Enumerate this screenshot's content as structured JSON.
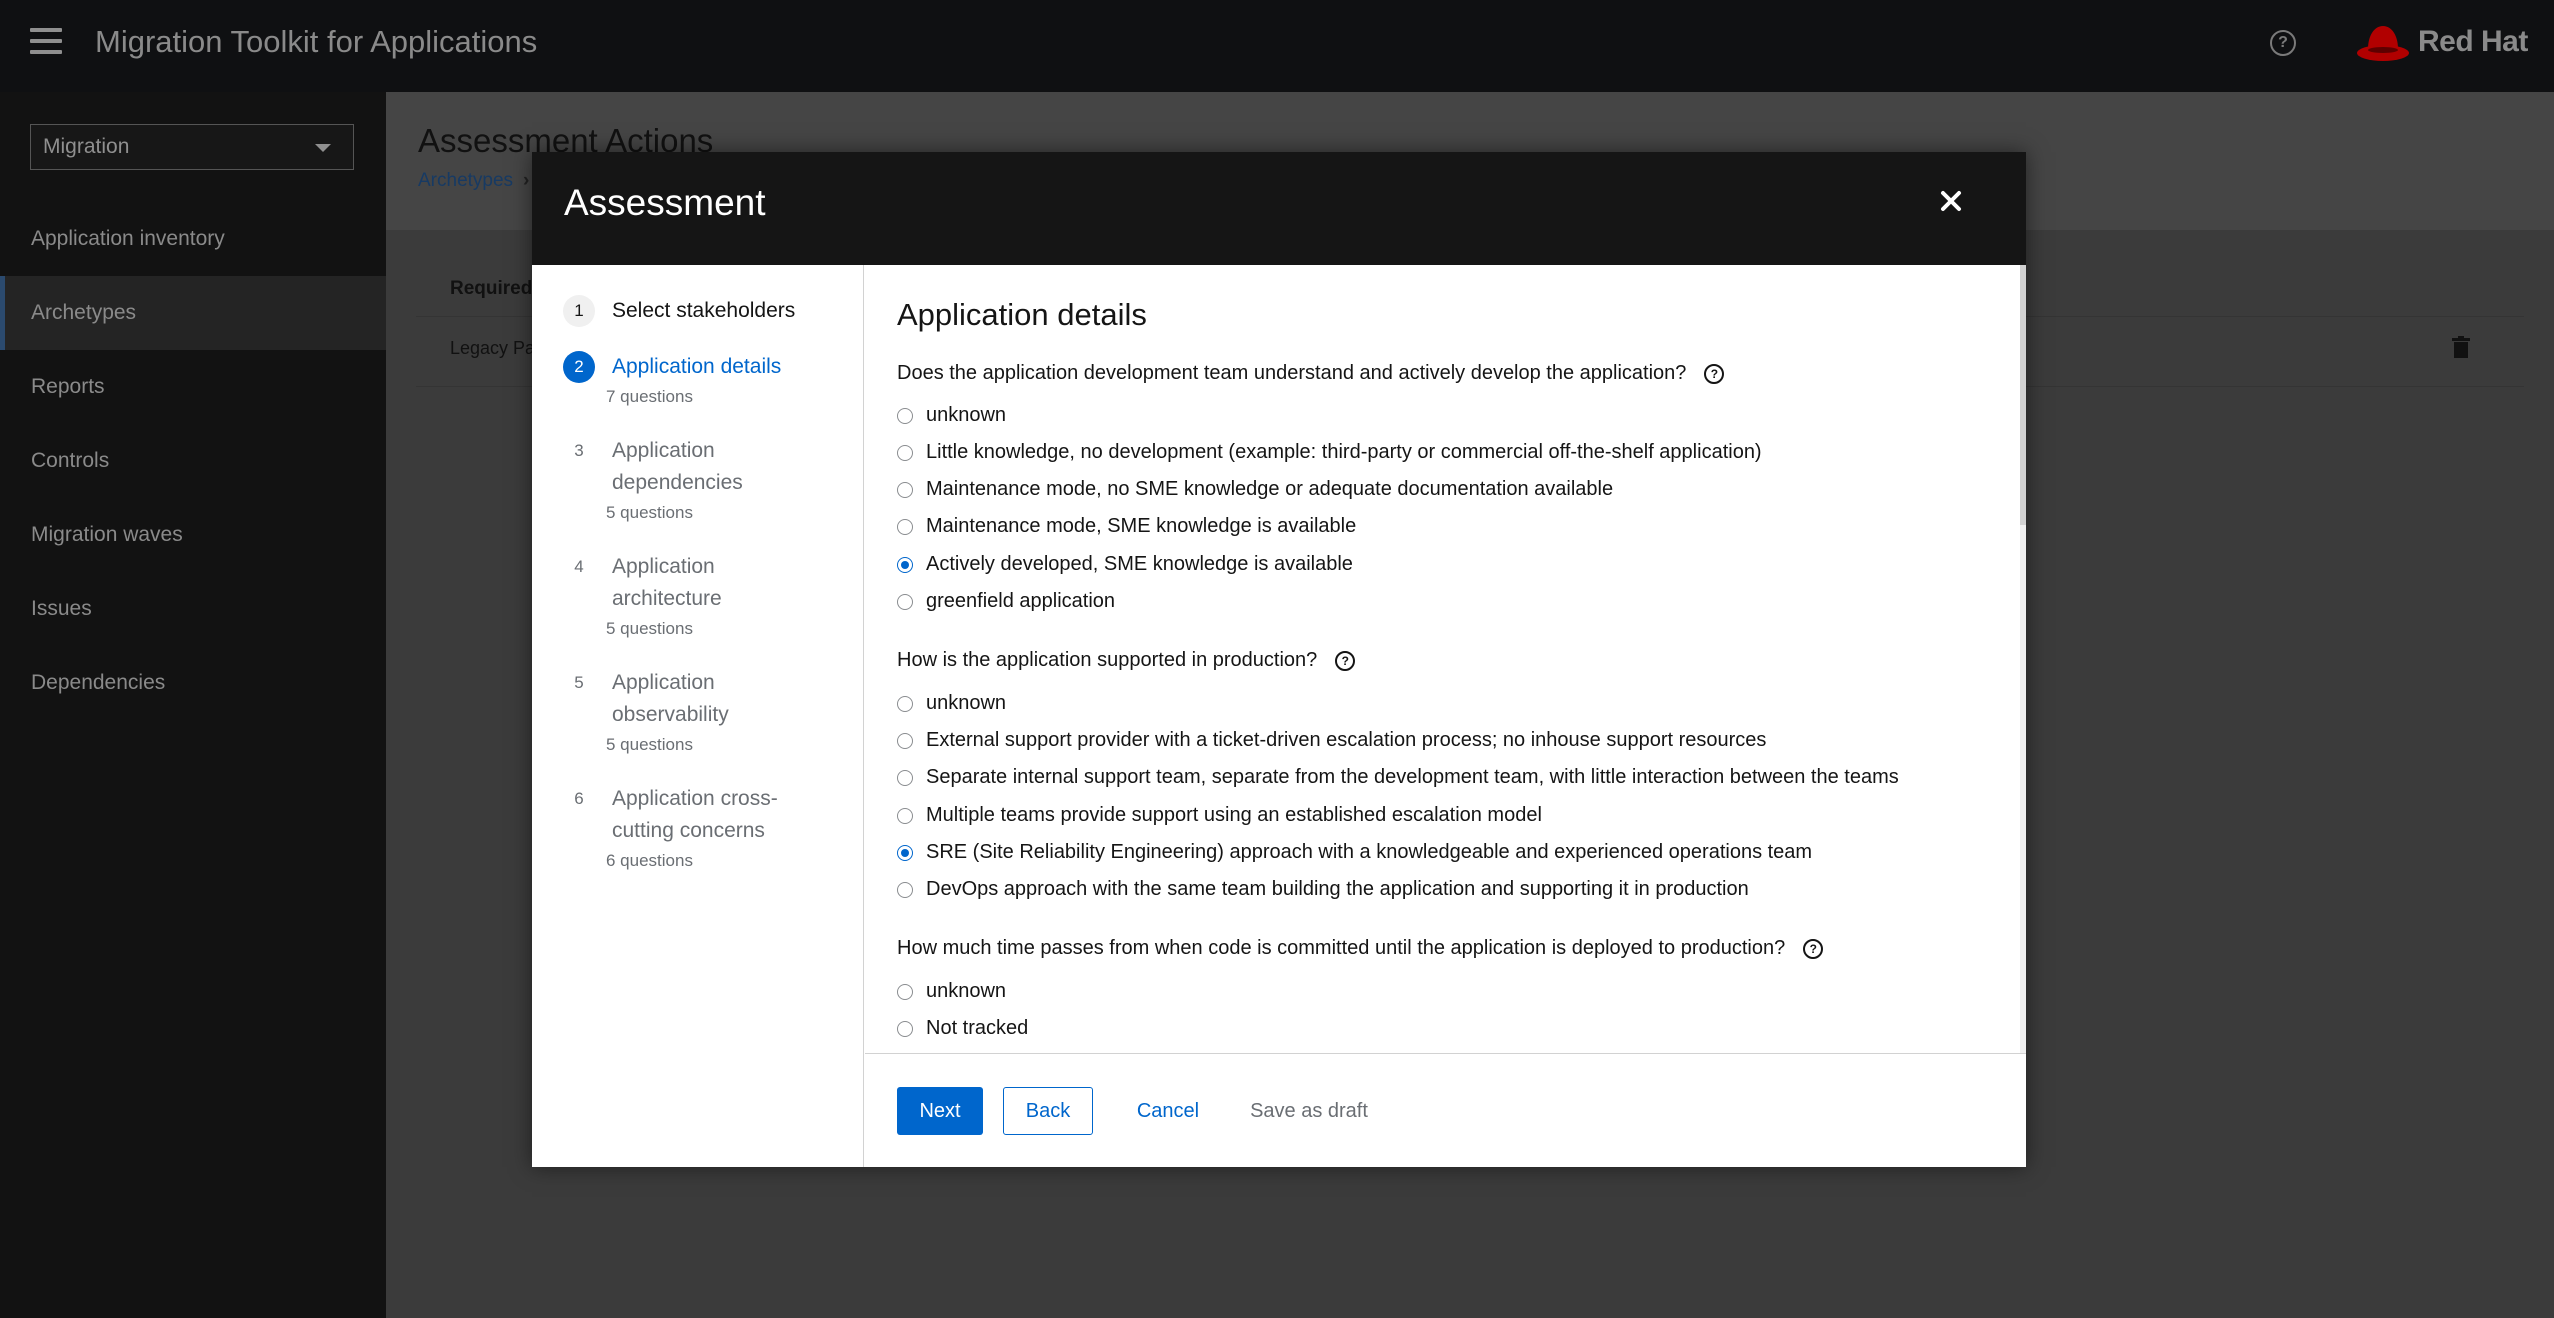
{
  "masthead": {
    "title": "Migration Toolkit for Applications",
    "logo_text": "Red Hat"
  },
  "sidebar": {
    "context": "Migration",
    "items": [
      {
        "label": "Application inventory",
        "active": false
      },
      {
        "label": "Archetypes",
        "active": true
      },
      {
        "label": "Reports",
        "active": false
      },
      {
        "label": "Controls",
        "active": false
      },
      {
        "label": "Migration waves",
        "active": false
      },
      {
        "label": "Issues",
        "active": false
      },
      {
        "label": "Dependencies",
        "active": false
      }
    ]
  },
  "page": {
    "title": "Assessment Actions",
    "breadcrumb": "Archetypes",
    "table_header": "Required",
    "row_text": "Legacy Pa"
  },
  "modal": {
    "title": "Assessment",
    "steps": [
      {
        "number": "1",
        "label": "Select stakeholders",
        "sub": "",
        "state": "done"
      },
      {
        "number": "2",
        "label": "Application details",
        "sub": "7 questions",
        "state": "current"
      },
      {
        "number": "3",
        "label": "Application dependencies",
        "sub": "5 questions",
        "state": "pending"
      },
      {
        "number": "4",
        "label": "Application architecture",
        "sub": "5 questions",
        "state": "pending"
      },
      {
        "number": "5",
        "label": "Application observability",
        "sub": "5 questions",
        "state": "pending"
      },
      {
        "number": "6",
        "label": "Application cross-cutting concerns",
        "sub": "6 questions",
        "state": "pending"
      }
    ],
    "section_title": "Application details",
    "questions": [
      {
        "text": "Does the application development team understand and actively develop the application?",
        "options": [
          "unknown",
          "Little knowledge, no development (example: third-party or commercial off-the-shelf application)",
          "Maintenance mode, no SME knowledge or adequate documentation available",
          "Maintenance mode, SME knowledge is available",
          "Actively developed, SME knowledge is available",
          "greenfield application"
        ],
        "selected": 4
      },
      {
        "text": "How is the application supported in production?",
        "options": [
          "unknown",
          "External support provider with a ticket-driven escalation process; no inhouse support resources",
          "Separate internal support team, separate from the development team, with little interaction between the teams",
          "Multiple teams provide support using an established escalation model",
          "SRE (Site Reliability Engineering) approach with a knowledgeable and experienced operations team",
          "DevOps approach with the same team building the application and supporting it in production"
        ],
        "selected": 4
      },
      {
        "text": "How much time passes from when code is committed until the application is deployed to production?",
        "options": [
          "unknown",
          "Not tracked"
        ],
        "selected": -1
      }
    ],
    "buttons": {
      "next": "Next",
      "back": "Back",
      "cancel": "Cancel",
      "save_draft": "Save as draft"
    }
  },
  "colors": {
    "accent": "#0066cc",
    "masthead": "#0f1012",
    "sidebar": "#121212"
  }
}
